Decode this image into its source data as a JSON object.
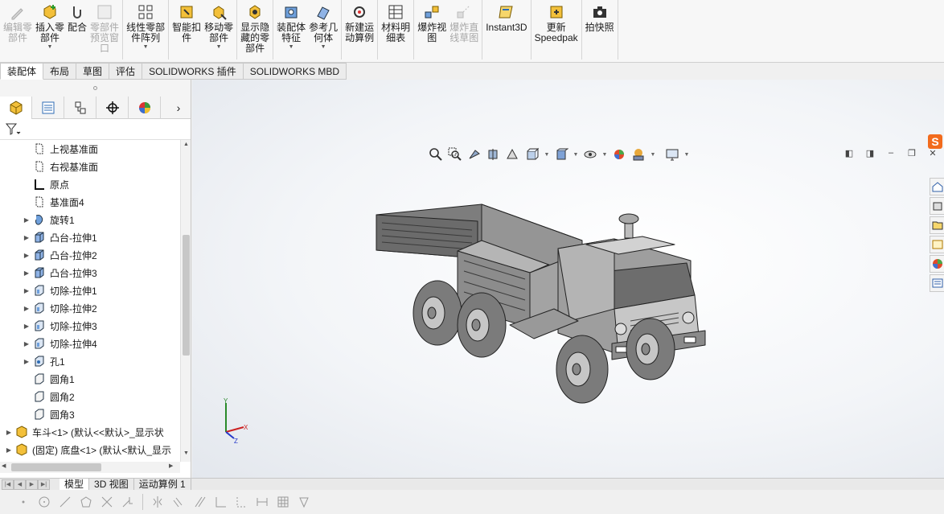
{
  "ribbon": {
    "buttons": [
      {
        "label": "编辑零\n部件",
        "icon": "edit-component-icon",
        "disabled": true,
        "arrow": false
      },
      {
        "label": "插入零\n部件",
        "icon": "insert-component-icon",
        "disabled": false,
        "arrow": true
      },
      {
        "label": "配合",
        "icon": "mate-icon",
        "disabled": false,
        "arrow": false
      },
      {
        "label": "零部件\n预览窗\n口",
        "icon": "component-preview-icon",
        "disabled": true,
        "arrow": false
      },
      {
        "label": "线性零部\n件阵列",
        "icon": "linear-pattern-icon",
        "disabled": false,
        "arrow": true
      },
      {
        "label": "智能扣\n件",
        "icon": "smart-fastener-icon",
        "disabled": false,
        "arrow": false
      },
      {
        "label": "移动零\n部件",
        "icon": "move-component-icon",
        "disabled": false,
        "arrow": true
      },
      {
        "label": "显示隐\n藏的零\n部件",
        "icon": "show-hidden-icon",
        "disabled": false,
        "arrow": false
      },
      {
        "label": "装配体\n特征",
        "icon": "assembly-feature-icon",
        "disabled": false,
        "arrow": true
      },
      {
        "label": "参考几\n何体",
        "icon": "reference-geometry-icon",
        "disabled": false,
        "arrow": true
      },
      {
        "label": "新建运\n动算例",
        "icon": "new-motion-study-icon",
        "disabled": false,
        "arrow": false
      },
      {
        "label": "材料明\n细表",
        "icon": "bom-icon",
        "disabled": false,
        "arrow": false
      },
      {
        "label": "爆炸视\n图",
        "icon": "exploded-view-icon",
        "disabled": false,
        "arrow": false
      },
      {
        "label": "爆炸直\n线草图",
        "icon": "explode-line-sketch-icon",
        "disabled": true,
        "arrow": false
      },
      {
        "label": "Instant3D",
        "icon": "instant3d-icon",
        "disabled": false,
        "arrow": false
      },
      {
        "label": "更新\nSpeedpak",
        "icon": "speedpak-icon",
        "disabled": false,
        "arrow": false
      },
      {
        "label": "拍快照",
        "icon": "snapshot-icon",
        "disabled": false,
        "arrow": false
      }
    ]
  },
  "tabs": [
    "装配体",
    "布局",
    "草图",
    "评估",
    "SOLIDWORKS 插件",
    "SOLIDWORKS MBD"
  ],
  "active_tab": "装配体",
  "tree": [
    {
      "label": "上视基准面",
      "icon": "plane-icon",
      "expand": false,
      "indent": 2
    },
    {
      "label": "右视基准面",
      "icon": "plane-icon",
      "expand": false,
      "indent": 2
    },
    {
      "label": "原点",
      "icon": "origin-icon",
      "expand": false,
      "indent": 2
    },
    {
      "label": "基准面4",
      "icon": "plane-icon",
      "expand": false,
      "indent": 2
    },
    {
      "label": "旋转1",
      "icon": "revolve-icon",
      "expand": true,
      "indent": 2
    },
    {
      "label": "凸台-拉伸1",
      "icon": "extrude-boss-icon",
      "expand": true,
      "indent": 2
    },
    {
      "label": "凸台-拉伸2",
      "icon": "extrude-boss-icon",
      "expand": true,
      "indent": 2
    },
    {
      "label": "凸台-拉伸3",
      "icon": "extrude-boss-icon",
      "expand": true,
      "indent": 2
    },
    {
      "label": "切除-拉伸1",
      "icon": "extrude-cut-icon",
      "expand": true,
      "indent": 2
    },
    {
      "label": "切除-拉伸2",
      "icon": "extrude-cut-icon",
      "expand": true,
      "indent": 2
    },
    {
      "label": "切除-拉伸3",
      "icon": "extrude-cut-icon",
      "expand": true,
      "indent": 2
    },
    {
      "label": "切除-拉伸4",
      "icon": "extrude-cut-icon",
      "expand": true,
      "indent": 2
    },
    {
      "label": "孔1",
      "icon": "hole-icon",
      "expand": true,
      "indent": 2
    },
    {
      "label": "圆角1",
      "icon": "fillet-icon",
      "expand": false,
      "indent": 2
    },
    {
      "label": "圆角2",
      "icon": "fillet-icon",
      "expand": false,
      "indent": 2
    },
    {
      "label": "圆角3",
      "icon": "fillet-icon",
      "expand": false,
      "indent": 2
    },
    {
      "label": "车斗<1> (默认<<默认>_显示状",
      "icon": "part-icon",
      "expand": true,
      "indent": 0
    },
    {
      "label": "(固定) 底盘<1> (默认<默认_显示",
      "icon": "part-icon",
      "expand": true,
      "indent": 0
    }
  ],
  "bottom_tabs": [
    "模型",
    "3D 视图",
    "运动算例 1"
  ],
  "active_bottom_tab": "模型",
  "triad": {
    "x": "X",
    "y": "Y",
    "z": "Z"
  },
  "colors": {
    "accent_blue": "#2f6db5",
    "truck_gray": "#8a8a8a",
    "ribbon_bg": "#f7f7f7"
  }
}
